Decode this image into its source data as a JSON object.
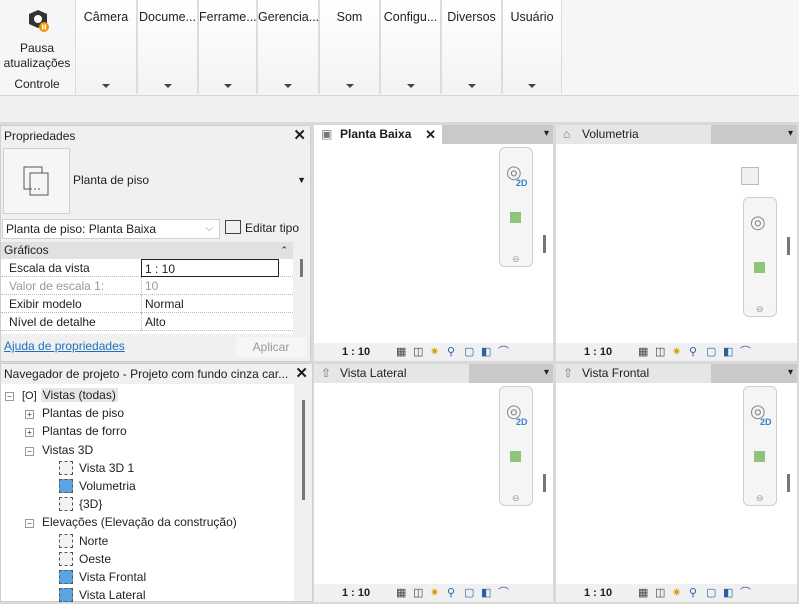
{
  "ribbon": {
    "control": {
      "label1": "Pausa",
      "label2": "atualizações",
      "group": "Controle"
    },
    "panels": [
      "Câmera",
      "Docume...",
      "Ferrame...",
      "Gerencia...",
      "Som",
      "Configu...",
      "Diversos",
      "Usuário"
    ]
  },
  "properties": {
    "title": "Propriedades",
    "type_name": "Planta de piso",
    "type_selector": "Planta de piso: Planta Baixa",
    "edit_type": "Editar tipo",
    "section": "Gráficos",
    "rows": [
      {
        "label": "Escala da vista",
        "value": "1 : 10"
      },
      {
        "label": "Valor de escala    1:",
        "value": "10"
      },
      {
        "label": "Exibir modelo",
        "value": "Normal"
      },
      {
        "label": "Nível de detalhe",
        "value": "Alto"
      }
    ],
    "help_link": "Ajuda de propriedades",
    "apply": "Aplicar"
  },
  "browser": {
    "title": "Navegador de projeto - Projeto com fundo cinza car...",
    "items": [
      {
        "label": "Vistas (todas)",
        "level": 0,
        "kind": "root"
      },
      {
        "label": "Plantas de piso",
        "level": 1,
        "kind": "plus"
      },
      {
        "label": "Plantas de forro",
        "level": 1,
        "kind": "plus"
      },
      {
        "label": "Vistas 3D",
        "level": 1,
        "kind": "minus"
      },
      {
        "label": "Vista 3D 1",
        "level": 2,
        "kind": "box"
      },
      {
        "label": "Volumetria",
        "level": 2,
        "kind": "on"
      },
      {
        "label": "{3D}",
        "level": 2,
        "kind": "box"
      },
      {
        "label": "Elevações (Elevação da construção)",
        "level": 1,
        "kind": "minus"
      },
      {
        "label": "Norte",
        "level": 2,
        "kind": "box"
      },
      {
        "label": "Oeste",
        "level": 2,
        "kind": "box"
      },
      {
        "label": "Vista Frontal",
        "level": 2,
        "kind": "on"
      },
      {
        "label": "Vista Lateral",
        "level": 2,
        "kind": "on"
      }
    ]
  },
  "views": [
    {
      "title": "Planta Baixa",
      "active": true,
      "scale": "1 : 10",
      "drawing": "plan",
      "nav2d": "2D"
    },
    {
      "title": "Volumetria",
      "active": false,
      "scale": "1 : 10",
      "drawing": "iso"
    },
    {
      "title": "Vista Lateral",
      "active": false,
      "scale": "1 : 10",
      "drawing": "side",
      "nav2d": "2D"
    },
    {
      "title": "Vista Frontal",
      "active": false,
      "scale": "1 : 10",
      "drawing": "front",
      "nav2d": "2D"
    }
  ]
}
